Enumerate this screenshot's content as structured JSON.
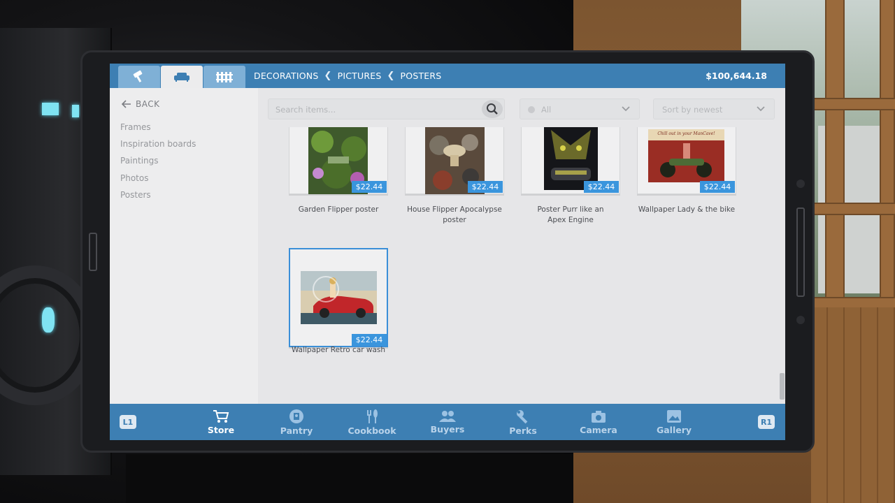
{
  "header": {
    "tabs": [
      {
        "icon": "paint-roller-icon",
        "active": false
      },
      {
        "icon": "sofa-icon",
        "active": true
      },
      {
        "icon": "fence-icon",
        "active": false
      }
    ],
    "breadcrumb": [
      "DECORATIONS",
      "PICTURES",
      "POSTERS"
    ],
    "money": "$100,644.18"
  },
  "sidebar": {
    "back_label": "BACK",
    "categories": [
      "Frames",
      "Inspiration boards",
      "Paintings",
      "Photos",
      "Posters"
    ]
  },
  "toolbar": {
    "search_placeholder": "Search items...",
    "filter_value": "All",
    "sort_value": "Sort by newest"
  },
  "items": [
    {
      "name": "Garden Flipper poster",
      "price": "$22.44",
      "selected": false
    },
    {
      "name": "House Flipper Apocalypse poster",
      "price": "$22.44",
      "selected": false
    },
    {
      "name": "Poster Purr like an Apex Engine",
      "price": "$22.44",
      "selected": false
    },
    {
      "name": "Wallpaper Lady & the bike",
      "price": "$22.44",
      "selected": false,
      "image_text": "Chill out in your ManCave!"
    },
    {
      "name": "Wallpaper Retro car wash",
      "price": "$22.44",
      "selected": true
    }
  ],
  "bottom_nav": {
    "left_shoulder": "L1",
    "right_shoulder": "R1",
    "items": [
      {
        "label": "Store",
        "icon": "cart-icon",
        "active": true
      },
      {
        "label": "Pantry",
        "icon": "pantry-icon",
        "active": false
      },
      {
        "label": "Cookbook",
        "icon": "cutlery-icon",
        "active": false
      },
      {
        "label": "Buyers",
        "icon": "people-icon",
        "active": false
      },
      {
        "label": "Perks",
        "icon": "wrench-icon",
        "active": false
      },
      {
        "label": "Camera",
        "icon": "camera-icon",
        "active": false
      },
      {
        "label": "Gallery",
        "icon": "image-icon",
        "active": false
      }
    ]
  },
  "colors": {
    "header_blue": "#3d7fb3",
    "price_tag_blue": "#3a95dd",
    "selection_blue": "#3a8fd8",
    "panel_gray": "#ececed"
  }
}
